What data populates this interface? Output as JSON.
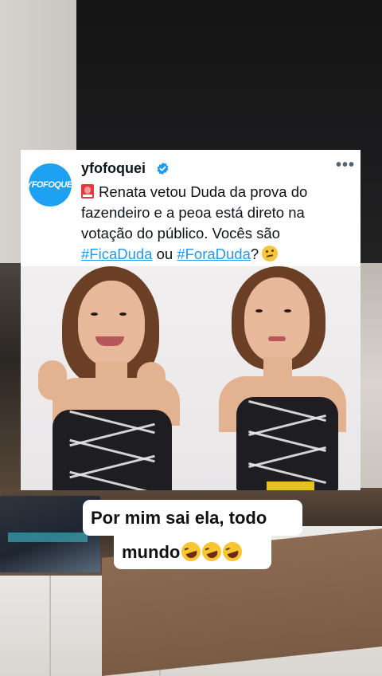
{
  "tweet": {
    "avatar_text": "YFOFOQUEI",
    "handle": "yfofoquei",
    "verified_icon": "verified-badge-icon",
    "more_label": "•••",
    "text_part1": "Renata vetou Duda da prova do fazendeiro e a peoa está direto na votação do público. Vocês são ",
    "hashtag1": "#FicaDuda",
    "text_part2": " ou ",
    "hashtag2": "#ForaDuda",
    "text_part3": "?",
    "leading_emoji": "rotating-light-icon",
    "trailing_emoji": "thinking-face-icon"
  },
  "caption": {
    "line1": "Por mim sai ela, todo",
    "line2": "mundo",
    "emojis": [
      "rofl-icon",
      "rofl-icon",
      "rofl-icon"
    ]
  },
  "colors": {
    "link": "#1d9bf0",
    "avatar_bg": "#1da1f2",
    "caption_bg": "#ffffff"
  }
}
